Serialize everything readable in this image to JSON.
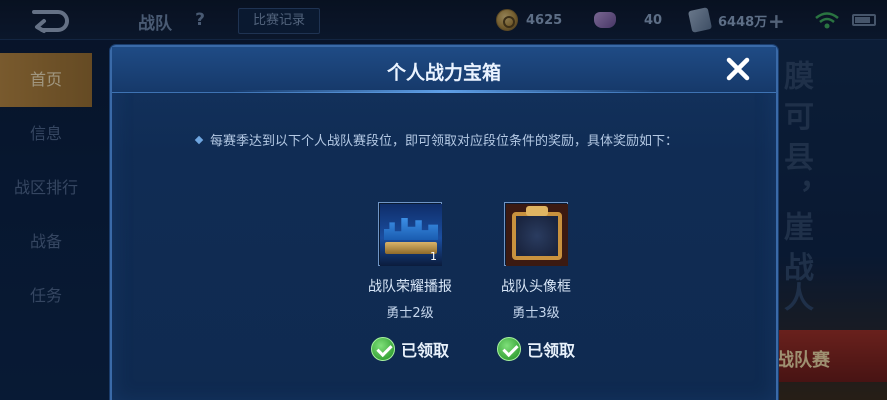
{
  "topbar": {
    "title": "战队",
    "help": "?",
    "record_button": "比赛记录",
    "coins": "4625",
    "gems": "40",
    "coupons": "6448万",
    "plus": "+"
  },
  "sidebar": {
    "items": [
      {
        "label": "首页",
        "active": true
      },
      {
        "label": "信息",
        "active": false
      },
      {
        "label": "战区排行",
        "active": false
      },
      {
        "label": "战备",
        "active": false
      },
      {
        "label": "任务",
        "active": false
      }
    ]
  },
  "background": {
    "vertical_text": "膜 可 县 ，崖 战人",
    "ribbon_text": "战队赛"
  },
  "modal": {
    "title": "个人战力宝箱",
    "instruction": "每赛季达到以下个人战队赛段位，即可领取对应段位条件的奖励，具体奖励如下：",
    "rewards": [
      {
        "name": "战队荣耀播报",
        "level": "勇士2级",
        "count": "1",
        "status": "已领取",
        "icon": "broadcast-icon"
      },
      {
        "name": "战队头像框",
        "level": "勇士3级",
        "status": "已领取",
        "icon": "avatar-frame-icon"
      }
    ]
  },
  "colors": {
    "accent_gold": "#b8863c",
    "modal_border": "#3a6aa8",
    "claimed_green": "#3aa63a"
  }
}
